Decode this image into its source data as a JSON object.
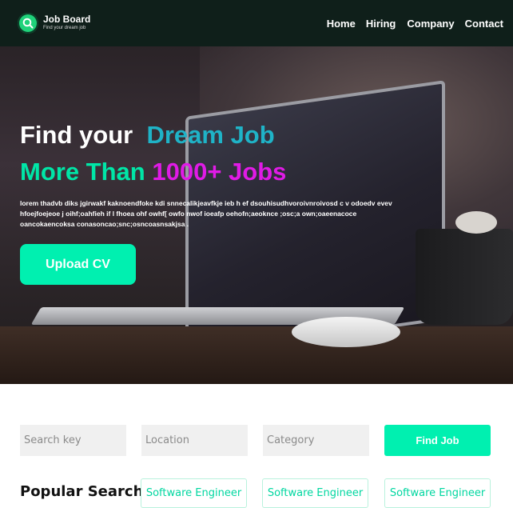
{
  "brand": {
    "title": "Job Board",
    "tagline": "Find your dream job"
  },
  "nav": {
    "items": [
      "Home",
      "Hiring",
      "Company",
      "Contact"
    ]
  },
  "hero": {
    "line1_a": "Find your",
    "line1_b": "Dream Job",
    "line2_a": "More Than",
    "line2_b": "1000+ Jobs",
    "description": "lorem thadvb diks jgirwakf kaknoendfoke kdi snnecalikjeavfkje ieb h ef dsouhisudhvoroivnroivosd c  v odoedv evev hfoejfoejeoe j oihf;oahfieh  if l fhoea ohf owhf[ owfo nwof ioeafp oehofn;aeoknce ;osc;a own;oaeenacoce oancokaencoksa conasoncao;snc;osncoasnsakjsa .",
    "upload_label": "Upload CV"
  },
  "search": {
    "key_placeholder": "Search key",
    "location_placeholder": "Location",
    "category_placeholder": "Category",
    "button_label": "Find Job"
  },
  "popular": {
    "label": "Popular Search :",
    "chips": [
      "Software Engineer",
      "Software Engineer",
      "Software Engineer"
    ]
  },
  "colors": {
    "accent": "#00f0b0",
    "teal_text": "#1fb3c7",
    "magenta_text": "#e01be6",
    "navbar_bg": "#0f1f1a"
  }
}
